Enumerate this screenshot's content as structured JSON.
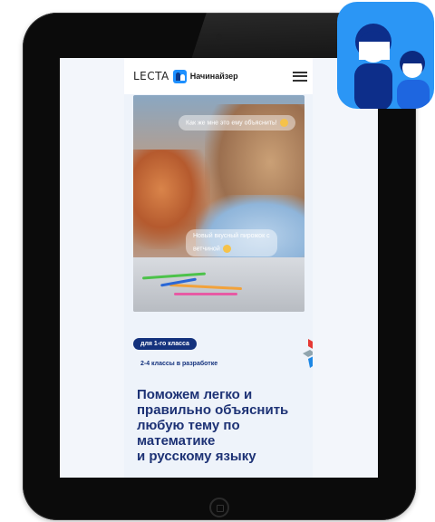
{
  "brand": {
    "name": "LECTA",
    "product": "Начинайзер"
  },
  "hero": {
    "bubble_1": "Как же мне это ему объяснить!",
    "bubble_2_line1": "Новый вкусный пирожок с",
    "bubble_2_line2": "ветчиной"
  },
  "info": {
    "badge": "для 1-го класса",
    "note": "2-4 классы в разработке",
    "headline_1": "Поможем легко и",
    "headline_2": "правильно объяснить",
    "headline_3": "любую тему по",
    "headline_4": "математике",
    "headline_5": "и русскому языку"
  },
  "icons": [
    "menu-icon",
    "lecta-logo-icon",
    "lecta-emblem-icon",
    "app-icon",
    "home-button-icon"
  ],
  "colors": {
    "navy": "#14327d",
    "brand_blue": "#1e90ff",
    "app_icon_bg": "#2b96f5"
  }
}
